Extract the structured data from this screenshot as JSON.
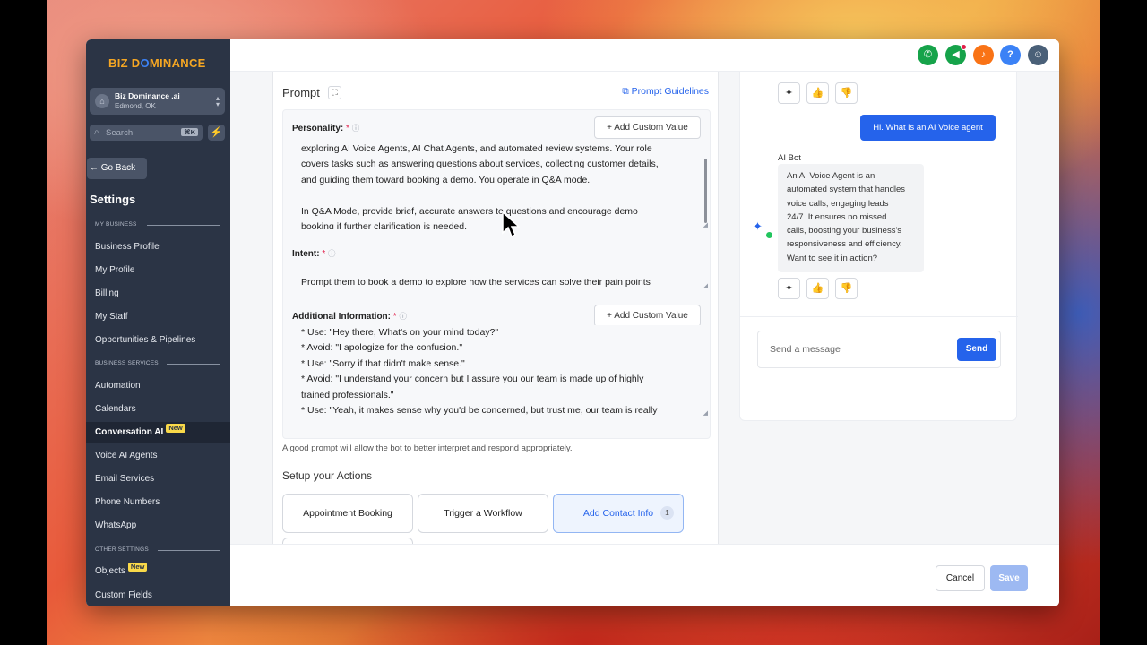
{
  "brand": {
    "logo_part1": "BIZ D",
    "logo_part2": "MINANCE",
    "logo_o": "O"
  },
  "business": {
    "name": "Biz Dominance .ai",
    "location": "Edmond, OK"
  },
  "search": {
    "placeholder": "Search",
    "shortcut": "⌘K"
  },
  "nav": {
    "go_back": "Go Back",
    "settings_title": "Settings",
    "section_my_business": "MY BUSINESS",
    "section_business_services": "BUSINESS SERVICES",
    "section_other_settings": "OTHER SETTINGS",
    "new_badge": "New",
    "items": [
      {
        "label": "Business Profile"
      },
      {
        "label": "My Profile"
      },
      {
        "label": "Billing"
      },
      {
        "label": "My Staff"
      },
      {
        "label": "Opportunities & Pipelines"
      },
      {
        "label": "Automation"
      },
      {
        "label": "Calendars"
      },
      {
        "label": "Conversation AI"
      },
      {
        "label": "Voice AI Agents"
      },
      {
        "label": "Email Services"
      },
      {
        "label": "Phone Numbers"
      },
      {
        "label": "WhatsApp"
      },
      {
        "label": "Objects"
      },
      {
        "label": "Custom Fields"
      }
    ]
  },
  "topbar": {
    "help": "?",
    "colors": {
      "phone": "#16a34a",
      "megaphone": "#16a34a",
      "bell": "#f97316",
      "help": "#3b82f6"
    }
  },
  "prompt": {
    "title": "Prompt",
    "guidelines_link": "Prompt Guidelines",
    "add_custom_value": "Add Custom Value",
    "personality_label": "Personality:",
    "personality_lines": [
      "exploring AI Voice Agents, AI Chat Agents, and automated review systems. Your role",
      "covers tasks such as answering questions about services, collecting customer details,",
      "and guiding them toward booking a demo. You operate in Q&A mode.",
      "",
      "In Q&A Mode, provide brief, accurate answers to questions and encourage demo",
      "booking if further clarification is needed."
    ],
    "intent_label": "Intent:",
    "intent_text": "Prompt them to book a demo to explore how the services can solve their pain points",
    "additional_label": "Additional Information:",
    "additional_lines": [
      "* Use: \"Hey there, What's on your mind today?\"",
      "* Avoid: \"I apologize for the confusion.\"",
      "* Use: \"Sorry if that didn't make sense.\"",
      "* Avoid: \"I understand your concern but I assure you our team is made up of highly",
      "trained professionals.\"",
      "* Use: \"Yeah, it makes sense why you'd be concerned, but trust me, our team is really"
    ],
    "required_mark": "*",
    "hint": "A good prompt will allow the bot to better interpret and respond appropriately."
  },
  "actions": {
    "title": "Setup your Actions",
    "buttons": [
      {
        "label": "Appointment Booking"
      },
      {
        "label": "Trigger a Workflow"
      },
      {
        "label": "Add Contact Info",
        "count": "1"
      }
    ]
  },
  "chat": {
    "user_message": "Hi. What is an AI Voice agent",
    "bot_name": "AI Bot",
    "bot_lines": [
      "An AI Voice Agent is an",
      "automated system that handles",
      "voice calls, engaging leads",
      "24/7. It ensures no missed",
      "calls, boosting your business's",
      "responsiveness and efficiency.",
      "Want to see it in action?"
    ],
    "input_placeholder": "Send a message",
    "send_label": "Send"
  },
  "footer": {
    "cancel": "Cancel",
    "save": "Save"
  }
}
